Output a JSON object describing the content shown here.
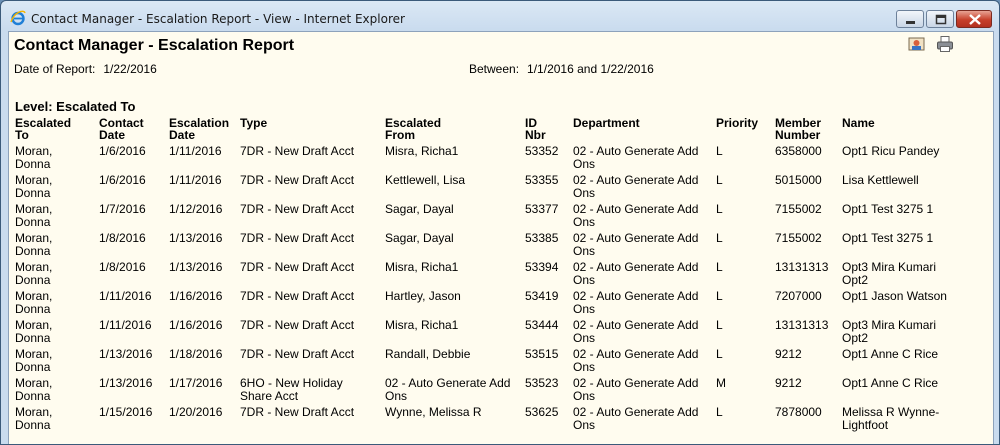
{
  "window": {
    "title": "Contact Manager - Escalation Report - View - Internet Explorer"
  },
  "report": {
    "title": "Contact Manager - Escalation Report",
    "date_label": "Date of Report:",
    "date_value": "1/22/2016",
    "between_label": "Between:",
    "between_value": "1/1/2016 and 1/22/2016",
    "level_heading": "Level: Escalated To"
  },
  "columns": [
    {
      "line1": "Escalated",
      "line2": "To"
    },
    {
      "line1": "Contact",
      "line2": "Date"
    },
    {
      "line1": "Escalation",
      "line2": "Date"
    },
    {
      "line1": "Type",
      "line2": ""
    },
    {
      "line1": "Escalated",
      "line2": "From"
    },
    {
      "line1": "ID",
      "line2": "Nbr"
    },
    {
      "line1": "Department",
      "line2": ""
    },
    {
      "line1": "Priority",
      "line2": ""
    },
    {
      "line1": "Member",
      "line2": "Number"
    },
    {
      "line1": "Name",
      "line2": ""
    }
  ],
  "rows": [
    {
      "to1": "Moran,",
      "to2": "Donna",
      "contact": "1/6/2016",
      "esc": "1/11/2016",
      "type1": "7DR - New Draft Acct",
      "type2": "",
      "from1": "Misra, Richa1",
      "from2": "",
      "id": "53352",
      "dept1": "02 - Auto Generate Add",
      "dept2": "Ons",
      "priority": "L",
      "member": "6358000",
      "name1": "Opt1 Ricu Pandey",
      "name2": ""
    },
    {
      "to1": "Moran,",
      "to2": "Donna",
      "contact": "1/6/2016",
      "esc": "1/11/2016",
      "type1": "7DR - New Draft Acct",
      "type2": "",
      "from1": "Kettlewell, Lisa",
      "from2": "",
      "id": "53355",
      "dept1": "02 - Auto Generate Add",
      "dept2": "Ons",
      "priority": "L",
      "member": "5015000",
      "name1": "Lisa Kettlewell",
      "name2": ""
    },
    {
      "to1": "Moran,",
      "to2": "Donna",
      "contact": "1/7/2016",
      "esc": "1/12/2016",
      "type1": "7DR - New Draft Acct",
      "type2": "",
      "from1": "Sagar, Dayal",
      "from2": "",
      "id": "53377",
      "dept1": "02 - Auto Generate Add",
      "dept2": "Ons",
      "priority": "L",
      "member": "7155002",
      "name1": "Opt1 Test 3275 1",
      "name2": ""
    },
    {
      "to1": "Moran,",
      "to2": "Donna",
      "contact": "1/8/2016",
      "esc": "1/13/2016",
      "type1": "7DR - New Draft Acct",
      "type2": "",
      "from1": "Sagar, Dayal",
      "from2": "",
      "id": "53385",
      "dept1": "02 - Auto Generate Add",
      "dept2": "Ons",
      "priority": "L",
      "member": "7155002",
      "name1": "Opt1 Test 3275 1",
      "name2": ""
    },
    {
      "to1": "Moran,",
      "to2": "Donna",
      "contact": "1/8/2016",
      "esc": "1/13/2016",
      "type1": "7DR - New Draft Acct",
      "type2": "",
      "from1": "Misra, Richa1",
      "from2": "",
      "id": "53394",
      "dept1": "02 - Auto Generate Add",
      "dept2": "Ons",
      "priority": "L",
      "member": "13131313",
      "name1": "Opt3 Mira Kumari",
      "name2": "Opt2"
    },
    {
      "to1": "Moran,",
      "to2": "Donna",
      "contact": "1/11/2016",
      "esc": "1/16/2016",
      "type1": "7DR - New Draft Acct",
      "type2": "",
      "from1": "Hartley, Jason",
      "from2": "",
      "id": "53419",
      "dept1": "02 - Auto Generate Add",
      "dept2": "Ons",
      "priority": "L",
      "member": "7207000",
      "name1": "Opt1 Jason Watson",
      "name2": ""
    },
    {
      "to1": "Moran,",
      "to2": "Donna",
      "contact": "1/11/2016",
      "esc": "1/16/2016",
      "type1": "7DR - New Draft Acct",
      "type2": "",
      "from1": "Misra, Richa1",
      "from2": "",
      "id": "53444",
      "dept1": "02 - Auto Generate Add",
      "dept2": "Ons",
      "priority": "L",
      "member": "13131313",
      "name1": "Opt3 Mira Kumari",
      "name2": "Opt2"
    },
    {
      "to1": "Moran,",
      "to2": "Donna",
      "contact": "1/13/2016",
      "esc": "1/18/2016",
      "type1": "7DR - New Draft Acct",
      "type2": "",
      "from1": "Randall, Debbie",
      "from2": "",
      "id": "53515",
      "dept1": "02 - Auto Generate Add",
      "dept2": "Ons",
      "priority": "L",
      "member": "9212",
      "name1": "Opt1 Anne C Rice",
      "name2": ""
    },
    {
      "to1": "Moran,",
      "to2": "Donna",
      "contact": "1/13/2016",
      "esc": "1/17/2016",
      "type1": "6HO - New Holiday",
      "type2": "Share Acct",
      "from1": "02 - Auto Generate Add",
      "from2": "Ons",
      "id": "53523",
      "dept1": "02 - Auto Generate Add",
      "dept2": "Ons",
      "priority": "M",
      "member": "9212",
      "name1": "Opt1 Anne C Rice",
      "name2": ""
    },
    {
      "to1": "Moran,",
      "to2": "Donna",
      "contact": "1/15/2016",
      "esc": "1/20/2016",
      "type1": "7DR - New Draft Acct",
      "type2": "",
      "from1": "Wynne, Melissa R",
      "from2": "",
      "id": "53625",
      "dept1": "02 - Auto Generate Add",
      "dept2": "Ons",
      "priority": "L",
      "member": "7878000",
      "name1": "Melissa R Wynne-",
      "name2": "Lightfoot"
    }
  ],
  "icons": {
    "app": "internet-explorer-icon",
    "toolbar": [
      "user-icon",
      "printer-icon"
    ],
    "window_controls": [
      "minimize-icon",
      "maximize-icon",
      "close-icon"
    ]
  }
}
